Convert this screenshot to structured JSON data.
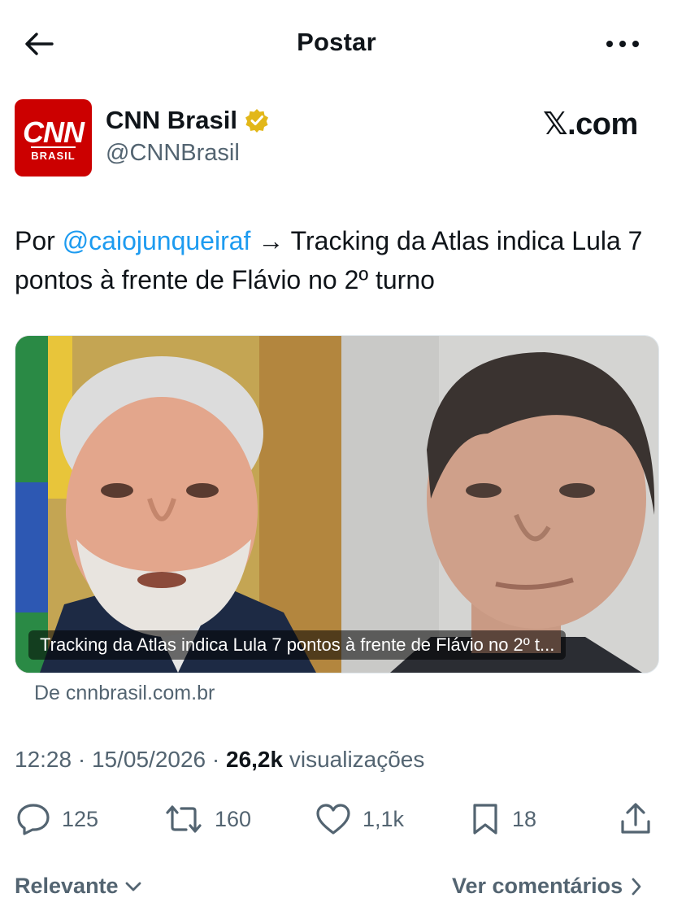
{
  "header": {
    "title": "Postar",
    "back_icon": "arrow-left-icon",
    "more_icon": "more-horizontal-icon"
  },
  "author": {
    "avatar_text": "CNN",
    "avatar_subtext": "BRASIL",
    "name": "CNN Brasil",
    "handle": "@CNNBrasil",
    "verified_color": "#e2b719",
    "brand_color": "#cc0000"
  },
  "watermark": "𝕏.com",
  "tweet": {
    "prefix": "Por ",
    "mention": "@caiojunqueiraf",
    "text": " → Tracking da Atlas indica Lula 7 pontos à frente de Flávio no 2º turno"
  },
  "card": {
    "caption": "Tracking da Atlas indica Lula 7 pontos à frente de Flávio no 2º t...",
    "source": "De cnnbrasil.com.br"
  },
  "meta": {
    "time": "12:28",
    "date": "15/05/2026",
    "views_count": "26,2k",
    "views_label": "visualizações"
  },
  "actions": {
    "replies": "125",
    "reposts": "160",
    "likes": "1,1k",
    "bookmarks": "18"
  },
  "bottom": {
    "sort_label": "Relevante",
    "comments_link": "Ver comentários"
  }
}
